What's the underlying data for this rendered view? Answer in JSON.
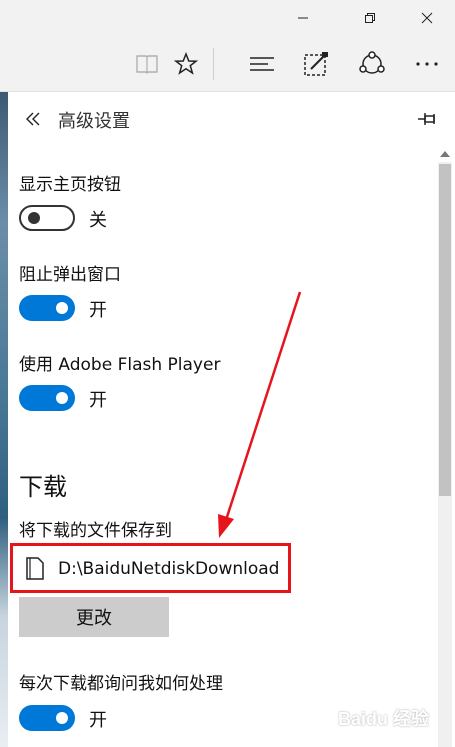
{
  "panel": {
    "title": "高级设置"
  },
  "settings": {
    "home_button": {
      "label": "显示主页按钮",
      "state": "关"
    },
    "block_popups": {
      "label": "阻止弹出窗口",
      "state": "开"
    },
    "flash": {
      "label": "使用 Adobe Flash Player",
      "state": "开"
    }
  },
  "downloads": {
    "section_title": "下载",
    "save_to_label": "将下载的文件保存到",
    "path": "D:\\BaiduNetdiskDownload",
    "change_label": "更改",
    "ask_label": "每次下载都询问我如何处理",
    "ask_state": "开"
  },
  "watermark": "Baidu 经验",
  "colors": {
    "accent": "#0078d7",
    "highlight_box": "#e8141c",
    "arrow": "#e8141c",
    "button_bg": "#cccccc"
  },
  "icons": {
    "minimize": "minimize-icon",
    "maximize": "restore-icon",
    "close": "close-icon",
    "reading_view": "book-icon",
    "favorites": "star-icon",
    "hub": "hub-icon",
    "web_note": "web-note-icon",
    "share": "share-icon",
    "more": "more-icon",
    "back": "double-chevron-left-icon",
    "pin": "pin-icon",
    "folder": "folder-icon"
  }
}
